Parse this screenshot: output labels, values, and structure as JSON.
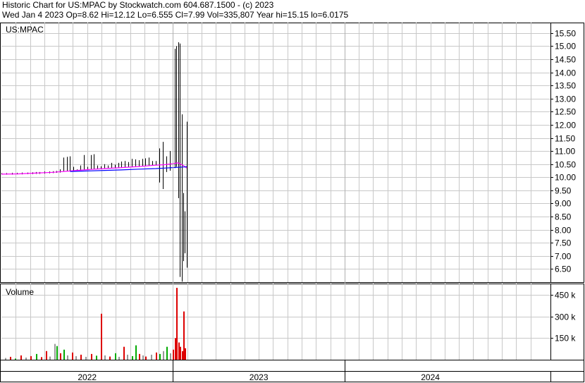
{
  "header": {
    "line1": "Historic Chart for US:MPAC by Stockwatch.com 604.687.1500 - (c) 2023",
    "line2": "Wed Jan  4 2023   Op=8.62   Hi=12.12   Lo=6.555   Cl=7.99   Vol=335,807   Year hi=15.15   lo=6.0175"
  },
  "chart_data": [
    {
      "type": "line",
      "title": "US:MPAC",
      "y_axis_side": "right",
      "ylim": [
        6.0,
        15.9
      ],
      "y_ticks": [
        "15.50",
        "15.00",
        "14.50",
        "14.00",
        "13.50",
        "13.00",
        "12.50",
        "12.00",
        "11.50",
        "11.00",
        "10.50",
        "10.00",
        "9.50",
        "9.00",
        "8.50",
        "8.00",
        "7.50",
        "7.00",
        "6.50"
      ],
      "grid": true,
      "series": [
        {
          "style": "price-range-bars",
          "color": "#000000",
          "x": [
            0.0,
            0.03,
            0.06,
            0.09,
            0.12,
            0.15,
            0.18,
            0.2,
            0.22,
            0.25,
            0.28,
            0.3,
            0.32,
            0.34,
            0.36,
            0.38,
            0.4,
            0.42,
            0.44,
            0.46,
            0.48,
            0.5,
            0.52,
            0.54,
            0.56,
            0.58,
            0.6,
            0.62,
            0.64,
            0.66,
            0.68,
            0.7,
            0.72,
            0.74,
            0.76,
            0.78,
            0.8,
            0.82,
            0.84,
            0.86,
            0.88,
            0.9,
            0.92,
            0.94,
            0.96,
            0.98,
            1.0,
            1.01,
            1.02,
            1.03,
            1.04,
            1.05,
            1.06,
            1.07,
            1.08
          ],
          "high": [
            10.16,
            10.16,
            10.17,
            10.17,
            10.18,
            10.18,
            10.19,
            10.2,
            10.2,
            10.22,
            10.22,
            10.23,
            10.24,
            10.3,
            10.75,
            10.78,
            10.8,
            10.4,
            10.3,
            10.45,
            10.85,
            10.4,
            10.85,
            10.88,
            10.45,
            10.42,
            10.5,
            10.45,
            10.55,
            10.48,
            10.55,
            10.6,
            10.62,
            10.58,
            10.7,
            10.68,
            10.65,
            10.7,
            10.72,
            10.75,
            10.62,
            10.62,
            11.1,
            11.35,
            10.8,
            11.0,
            14.85,
            14.9,
            15.0,
            15.15,
            15.1,
            12.4,
            9.4,
            8.7,
            12.12
          ],
          "low": [
            10.1,
            10.1,
            10.1,
            10.11,
            10.11,
            10.12,
            10.12,
            10.13,
            10.13,
            10.14,
            10.15,
            10.16,
            10.17,
            10.18,
            10.22,
            10.22,
            10.24,
            10.25,
            10.26,
            10.26,
            10.28,
            10.28,
            10.3,
            10.3,
            10.31,
            10.32,
            10.33,
            10.34,
            10.35,
            10.36,
            10.36,
            10.37,
            10.38,
            10.4,
            10.4,
            10.42,
            10.42,
            10.43,
            10.44,
            10.44,
            10.44,
            10.45,
            9.8,
            9.55,
            10.2,
            10.25,
            10.3,
            10.35,
            10.4,
            9.2,
            6.2,
            6.02,
            6.8,
            7.1,
            6.55
          ]
        },
        {
          "style": "moving-average",
          "color": "#ff00ff",
          "x": [
            0.0,
            0.1,
            0.2,
            0.3,
            0.4,
            0.5,
            0.6,
            0.7,
            0.8,
            0.9,
            0.95,
            1.0,
            1.03,
            1.06,
            1.08
          ],
          "values": [
            10.12,
            10.13,
            10.16,
            10.19,
            10.24,
            10.29,
            10.33,
            10.37,
            10.41,
            10.46,
            10.48,
            10.52,
            10.55,
            10.45,
            10.35
          ]
        },
        {
          "style": "moving-average",
          "color": "#0000ff",
          "x": [
            0.4,
            0.5,
            0.6,
            0.7,
            0.8,
            0.9,
            0.95,
            1.0,
            1.03,
            1.06,
            1.08
          ],
          "values": [
            10.22,
            10.24,
            10.26,
            10.28,
            10.31,
            10.33,
            10.35,
            10.37,
            10.38,
            10.39,
            10.4
          ]
        }
      ]
    },
    {
      "type": "bar",
      "title": "Volume",
      "y_axis_side": "right",
      "ylim": [
        0,
        530000
      ],
      "y_ticks": [
        "450 k",
        "300 k",
        "150 k"
      ],
      "up_color": "#00aa00",
      "down_color": "#dd0000",
      "neutral_color": "#999999",
      "bars": [
        {
          "x": 0.02,
          "v": 12000,
          "d": "neutral"
        },
        {
          "x": 0.05,
          "v": 20000,
          "d": "down"
        },
        {
          "x": 0.08,
          "v": 8000,
          "d": "up"
        },
        {
          "x": 0.11,
          "v": 30000,
          "d": "down"
        },
        {
          "x": 0.14,
          "v": 15000,
          "d": "neutral"
        },
        {
          "x": 0.17,
          "v": 25000,
          "d": "down"
        },
        {
          "x": 0.2,
          "v": 40000,
          "d": "up"
        },
        {
          "x": 0.23,
          "v": 18000,
          "d": "down"
        },
        {
          "x": 0.26,
          "v": 60000,
          "d": "down"
        },
        {
          "x": 0.28,
          "v": 22000,
          "d": "neutral"
        },
        {
          "x": 0.31,
          "v": 110000,
          "d": "neutral"
        },
        {
          "x": 0.32,
          "v": 95000,
          "d": "up"
        },
        {
          "x": 0.34,
          "v": 45000,
          "d": "down"
        },
        {
          "x": 0.36,
          "v": 70000,
          "d": "up"
        },
        {
          "x": 0.38,
          "v": 30000,
          "d": "neutral"
        },
        {
          "x": 0.41,
          "v": 50000,
          "d": "down"
        },
        {
          "x": 0.43,
          "v": 25000,
          "d": "neutral"
        },
        {
          "x": 0.46,
          "v": 35000,
          "d": "down"
        },
        {
          "x": 0.49,
          "v": 20000,
          "d": "neutral"
        },
        {
          "x": 0.52,
          "v": 40000,
          "d": "down"
        },
        {
          "x": 0.55,
          "v": 28000,
          "d": "up"
        },
        {
          "x": 0.58,
          "v": 320000,
          "d": "down"
        },
        {
          "x": 0.6,
          "v": 30000,
          "d": "neutral"
        },
        {
          "x": 0.63,
          "v": 22000,
          "d": "down"
        },
        {
          "x": 0.66,
          "v": 45000,
          "d": "up"
        },
        {
          "x": 0.68,
          "v": 20000,
          "d": "neutral"
        },
        {
          "x": 0.71,
          "v": 90000,
          "d": "down"
        },
        {
          "x": 0.73,
          "v": 35000,
          "d": "neutral"
        },
        {
          "x": 0.76,
          "v": 25000,
          "d": "up"
        },
        {
          "x": 0.78,
          "v": 100000,
          "d": "up"
        },
        {
          "x": 0.8,
          "v": 40000,
          "d": "down"
        },
        {
          "x": 0.82,
          "v": 30000,
          "d": "neutral"
        },
        {
          "x": 0.84,
          "v": 22000,
          "d": "down"
        },
        {
          "x": 0.87,
          "v": 35000,
          "d": "neutral"
        },
        {
          "x": 0.9,
          "v": 50000,
          "d": "down"
        },
        {
          "x": 0.92,
          "v": 40000,
          "d": "up"
        },
        {
          "x": 0.94,
          "v": 60000,
          "d": "neutral"
        },
        {
          "x": 0.96,
          "v": 90000,
          "d": "up"
        },
        {
          "x": 0.98,
          "v": 45000,
          "d": "neutral"
        },
        {
          "x": 1.0,
          "v": 70000,
          "d": "down"
        },
        {
          "x": 1.01,
          "v": 150000,
          "d": "down"
        },
        {
          "x": 1.02,
          "v": 500000,
          "d": "down"
        },
        {
          "x": 1.03,
          "v": 120000,
          "d": "down"
        },
        {
          "x": 1.04,
          "v": 90000,
          "d": "down"
        },
        {
          "x": 1.05,
          "v": 60000,
          "d": "down"
        },
        {
          "x": 1.06,
          "v": 335807,
          "d": "down"
        },
        {
          "x": 1.07,
          "v": 80000,
          "d": "down"
        }
      ]
    }
  ],
  "time_axis": {
    "labels": [
      "2022",
      "2023",
      "2024"
    ],
    "x_domain": [
      0,
      3.2
    ]
  }
}
